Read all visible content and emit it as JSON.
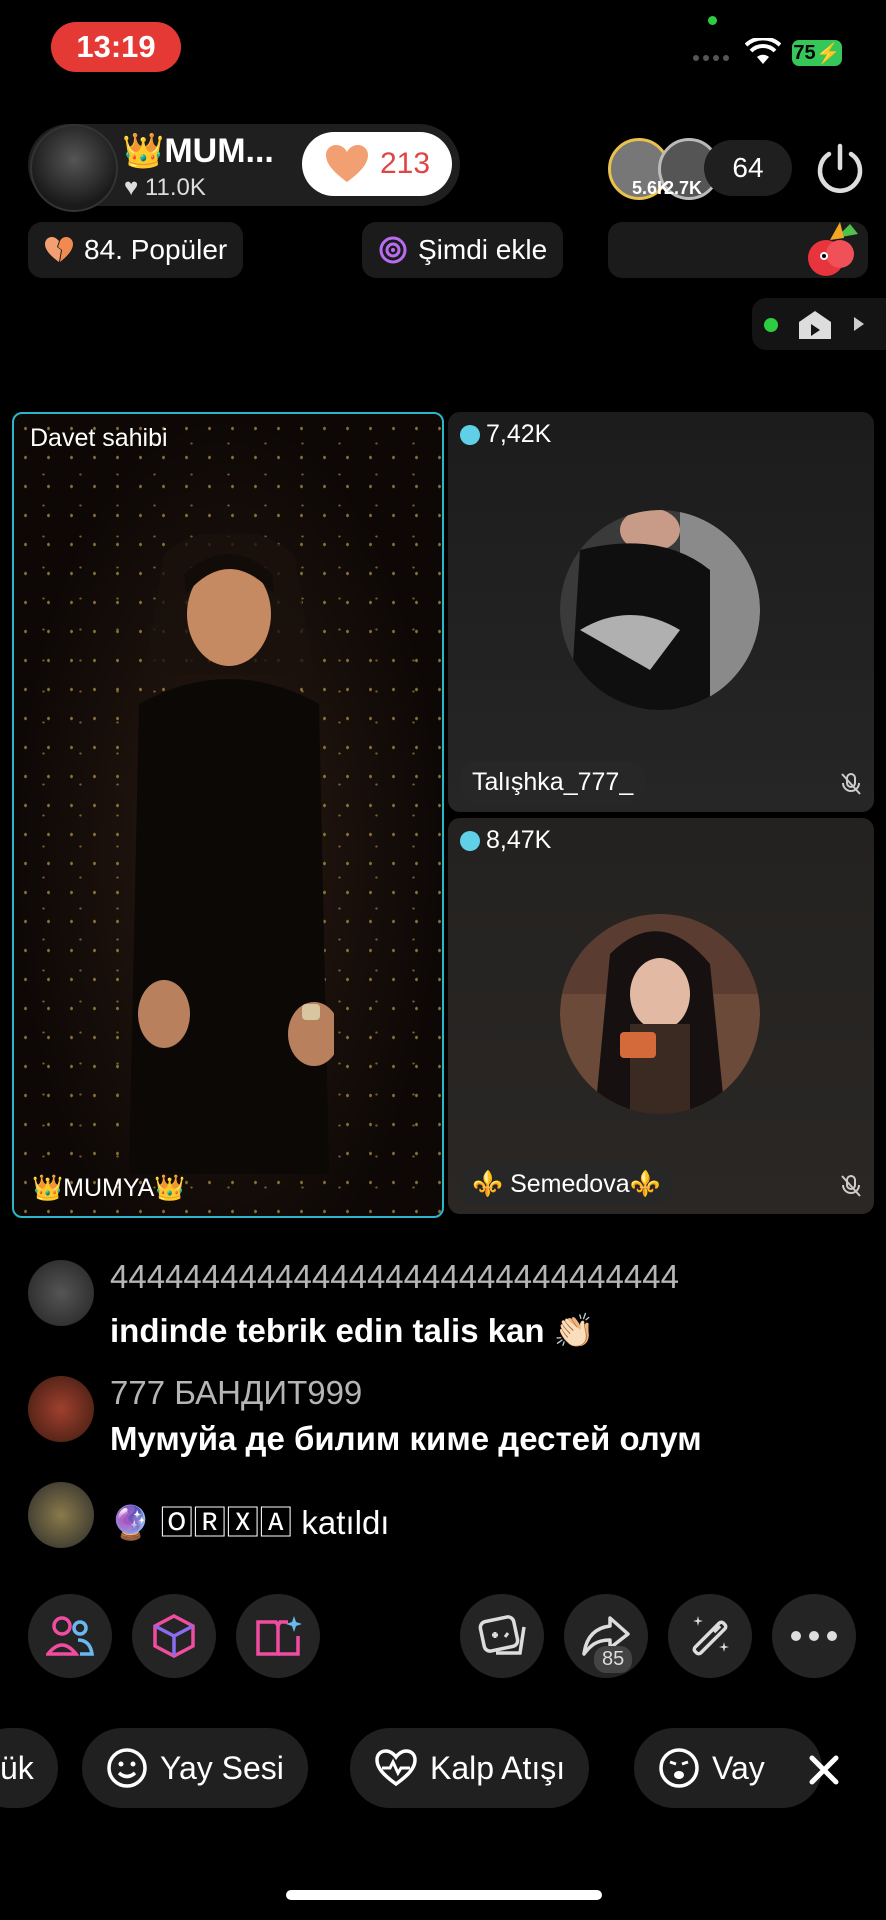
{
  "status_bar": {
    "time": "13:19",
    "battery": "75"
  },
  "host": {
    "name": "👑MUM...",
    "likes": "♥ 11.0K",
    "heart_count": "213"
  },
  "viewers": {
    "v1_count": "5.6K",
    "v2_count": "2.7K",
    "total": "64"
  },
  "chips": {
    "popular": "84. Popüler",
    "add_now": "Şimdi ekle"
  },
  "host_tile": {
    "label": "Davet sahibi",
    "name": "👑MUMYA👑"
  },
  "guest1": {
    "gems": "7,42K",
    "name": "Talışhka_777_"
  },
  "guest2": {
    "gems": "8,47K",
    "name": "⚜️ Semedova⚜️"
  },
  "chat": [
    {
      "name": "4444444444444444444444444444444",
      "message": "indinde tebrik edin talis kan 👏🏻"
    },
    {
      "name": "777 БАНДИТ999",
      "message": "Мумуйа  де билим киме дестей олум"
    },
    {
      "join_text": "🔮  🄾🅁🅇🄰 katıldı"
    }
  ],
  "share_count": "85",
  "sound_chips": [
    "ük",
    "Yay Sesi",
    "Kalp Atışı",
    "Vay"
  ],
  "colors": {
    "accent_teal": "#2bb7c9",
    "time_pill": "#e53935",
    "battery": "#35c759"
  }
}
